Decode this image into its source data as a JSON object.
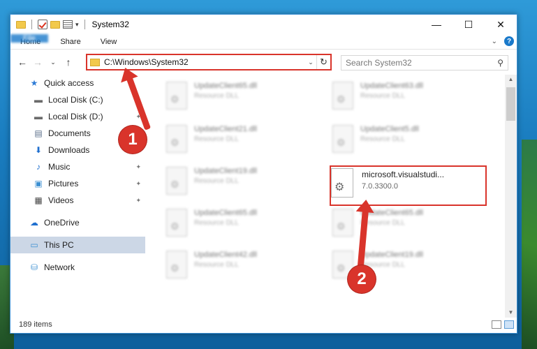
{
  "window": {
    "title": "System32",
    "controls": {
      "minimize": "—",
      "maximize": "☐",
      "close": "✕"
    }
  },
  "ribbon": {
    "tabs": [
      "File",
      "Home",
      "Share",
      "View"
    ],
    "collapse": "⌄",
    "help": "?"
  },
  "navbar": {
    "back": "←",
    "forward": "→",
    "recent": "⌄",
    "up": "↑",
    "address": "C:\\Windows\\System32",
    "address_dropdown": "⌄",
    "refresh": "↻"
  },
  "search": {
    "placeholder": "Search System32",
    "icon": "⚲"
  },
  "sidebar": {
    "items": [
      {
        "label": "Quick access",
        "icon": "star-icon",
        "glyph": "★",
        "color": "#2e7bd6"
      },
      {
        "label": "Local Disk (C:)",
        "icon": "drive-icon",
        "glyph": "▬",
        "pinned": true
      },
      {
        "label": "Local Disk (D:)",
        "icon": "drive-icon",
        "glyph": "▬",
        "pinned": true
      },
      {
        "label": "Documents",
        "icon": "documents-icon",
        "glyph": "▤",
        "pinned": true
      },
      {
        "label": "Downloads",
        "icon": "downloads-icon",
        "glyph": "⬇",
        "pinned": true
      },
      {
        "label": "Music",
        "icon": "music-icon",
        "glyph": "♪",
        "pinned": true
      },
      {
        "label": "Pictures",
        "icon": "pictures-icon",
        "glyph": "▣",
        "pinned": true
      },
      {
        "label": "Videos",
        "icon": "videos-icon",
        "glyph": "▦",
        "pinned": true
      },
      {
        "label": "OneDrive",
        "icon": "onedrive-icon",
        "glyph": "☁"
      },
      {
        "label": "This PC",
        "icon": "this-pc-icon",
        "glyph": "▭",
        "selected": true
      },
      {
        "label": "Network",
        "icon": "network-icon",
        "glyph": "⛁"
      }
    ],
    "pin_glyph": "📌"
  },
  "files": [
    {
      "name": "UpdateClient65.dll",
      "type": "Resource DLL"
    },
    {
      "name": "UpdateClient63.dll",
      "type": "Resource DLL"
    },
    {
      "name": "UpdateClient21.dll",
      "type": "Resource DLL"
    },
    {
      "name": "UpdateClient5.dll",
      "type": "Resource DLL"
    },
    {
      "name": "UpdateClient19.dll",
      "type": "Resource DLL"
    },
    {
      "name": "UpdateClient65.dll",
      "type": "Resource DLL"
    },
    {
      "name": "UpdateClient65.dll",
      "type": "Resource DLL"
    },
    {
      "name": "UpdateClient42.dll",
      "type": "Resource DLL"
    },
    {
      "name": "UpdateClient19.dll",
      "type": "Resource DLL"
    }
  ],
  "target_file": {
    "name": "microsoft.visualstudi...",
    "version": "7.0.3300.0",
    "icon": "gear-icon"
  },
  "annotations": {
    "step1": "1",
    "step2": "2",
    "color": "#d9342b"
  },
  "status": {
    "item_count": "189 items"
  }
}
